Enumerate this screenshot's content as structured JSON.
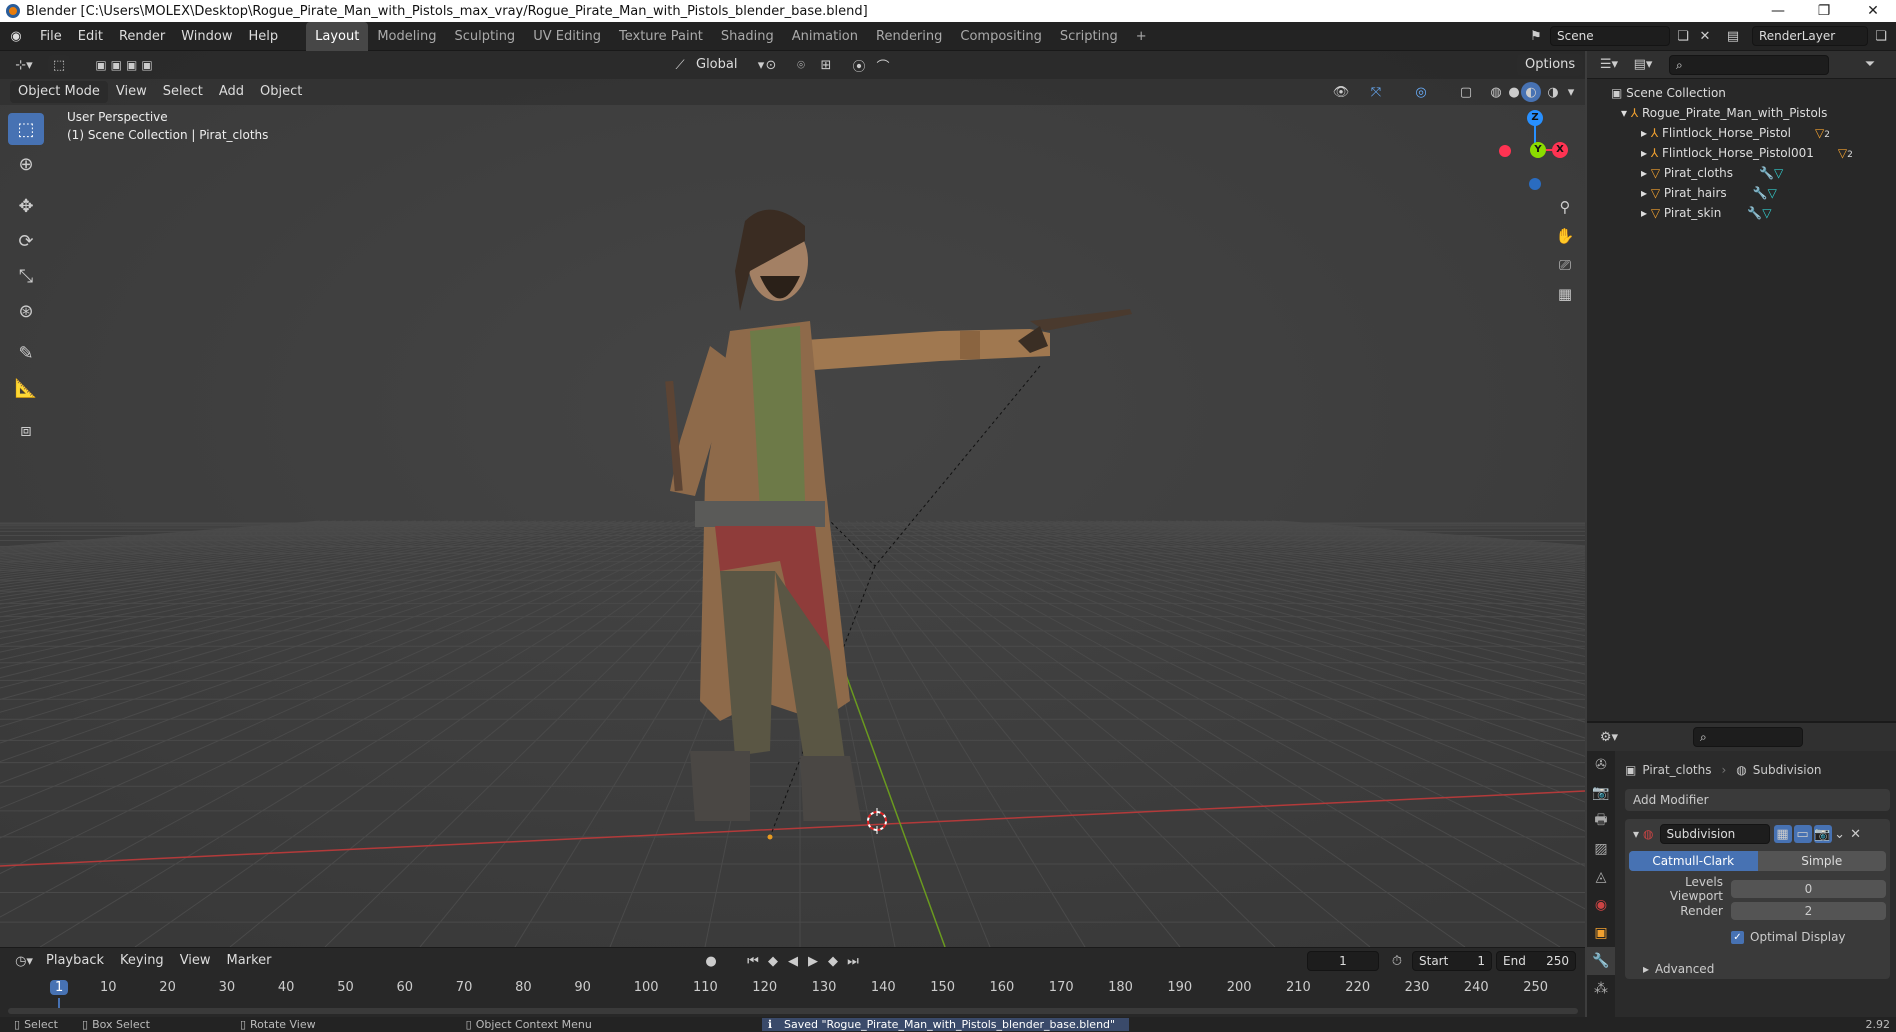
{
  "window": {
    "title": "Blender [C:\\Users\\MOLEX\\Desktop\\Rogue_Pirate_Man_with_Pistols_max_vray/Rogue_Pirate_Man_with_Pistols_blender_base.blend]",
    "minimize": "—",
    "restore": "❐",
    "close": "✕"
  },
  "menu": [
    "File",
    "Edit",
    "Render",
    "Window",
    "Help"
  ],
  "workspaces": [
    "Layout",
    "Modeling",
    "Sculpting",
    "UV Editing",
    "Texture Paint",
    "Shading",
    "Animation",
    "Rendering",
    "Compositing",
    "Scripting"
  ],
  "workspace_add": "+",
  "scene": {
    "label": "Scene",
    "render_layer": "RenderLayer"
  },
  "viewport_header": {
    "orientation": "Global",
    "options": "Options",
    "mode": "Object Mode",
    "menus": [
      "View",
      "Select",
      "Add",
      "Object"
    ]
  },
  "viewport": {
    "perspective": "User Perspective",
    "collection_info": "(1) Scene Collection | Pirat_cloths"
  },
  "gizmo": {
    "z": "Z",
    "y": "Y",
    "x": "X"
  },
  "outliner": {
    "root": "Scene Collection",
    "collection": "Rogue_Pirate_Man_with_Pistols",
    "items": [
      "Flintlock_Horse_Pistol",
      "Flintlock_Horse_Pistol001",
      "Pirat_cloths",
      "Pirat_hairs",
      "Pirat_skin"
    ],
    "badge": "2"
  },
  "properties": {
    "object": "Pirat_cloths",
    "modifier_breadcrumb": "Subdivision",
    "add_modifier": "Add Modifier",
    "modifier_name": "Subdivision",
    "seg_catmull": "Catmull-Clark",
    "seg_simple": "Simple",
    "levels_viewport_label": "Levels Viewport",
    "levels_viewport_value": "0",
    "render_label": "Render",
    "render_value": "2",
    "optimal_display": "Optimal Display",
    "advanced": "Advanced"
  },
  "timeline": {
    "menus": [
      "Playback",
      "Keying",
      "View",
      "Marker"
    ],
    "current_frame": "1",
    "start_label": "Start",
    "start_value": "1",
    "end_label": "End",
    "end_value": "250",
    "ticks": [
      "1",
      "10",
      "20",
      "30",
      "40",
      "50",
      "60",
      "70",
      "80",
      "90",
      "100",
      "110",
      "120",
      "130",
      "140",
      "150",
      "160",
      "170",
      "180",
      "190",
      "200",
      "210",
      "220",
      "230",
      "240",
      "250"
    ]
  },
  "status": {
    "select": "Select",
    "box_select": "Box Select",
    "rotate": "Rotate View",
    "context": "Object Context Menu",
    "message": "Saved \"Rogue_Pirate_Man_with_Pistols_blender_base.blend\"",
    "version": "2.92"
  },
  "colors": {
    "accent": "#4772b3",
    "x_axis": "#ff3352",
    "y_axis": "#8bdc00",
    "z_axis": "#2890ff"
  }
}
